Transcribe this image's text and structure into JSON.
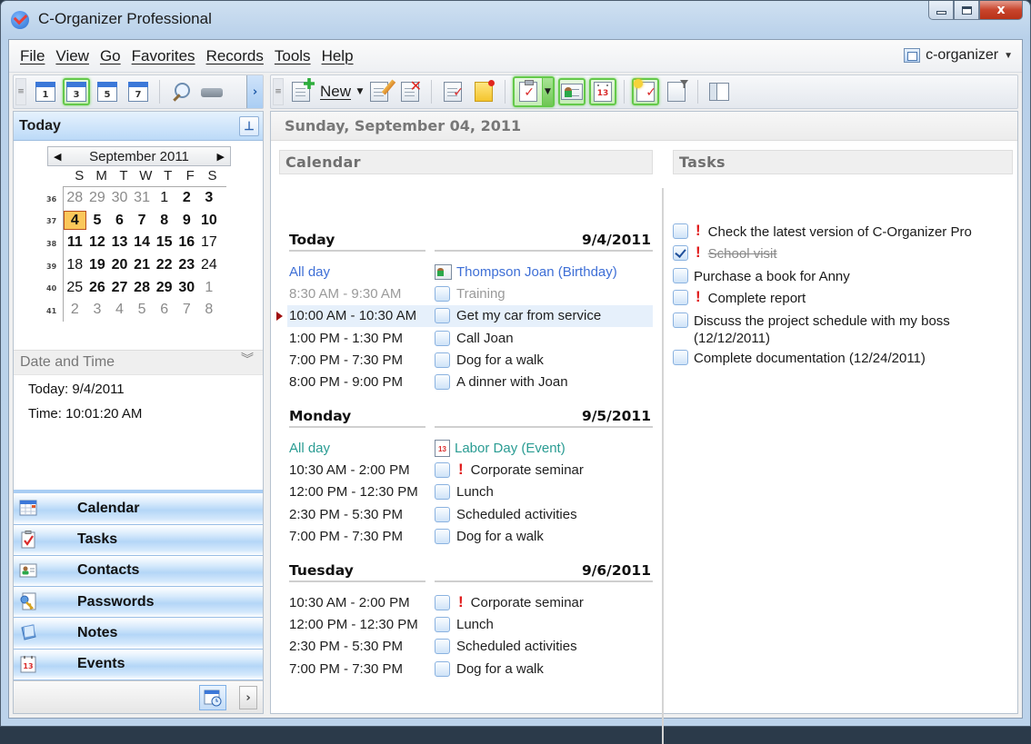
{
  "window": {
    "title": "C-Organizer Professional",
    "controls": {
      "minimize": "minimize",
      "maximize": "maximize",
      "close": "x"
    }
  },
  "menu": {
    "items": [
      "File",
      "View",
      "Go",
      "Favorites",
      "Records",
      "Tools",
      "Help"
    ],
    "profile": "c-organizer"
  },
  "left_toolbar": {
    "buttons": [
      {
        "name": "day-view",
        "label": "1",
        "active": false
      },
      {
        "name": "3-day-view",
        "label": "3",
        "active": true
      },
      {
        "name": "work-week-view",
        "label": "5",
        "active": false
      },
      {
        "name": "week-view",
        "label": "7",
        "active": false
      }
    ],
    "more": "›"
  },
  "right_toolbar": {
    "new_label": "New"
  },
  "today_panel": {
    "title": "Today",
    "pin": "⊥"
  },
  "mini_calendar": {
    "month_label": "September 2011",
    "weekdays": [
      "S",
      "M",
      "T",
      "W",
      "T",
      "F",
      "S"
    ],
    "weeks": [
      {
        "num": "36",
        "days": [
          [
            "28",
            "other"
          ],
          [
            "29",
            "other"
          ],
          [
            "30",
            "other"
          ],
          [
            "31",
            "other"
          ],
          [
            "1",
            ""
          ],
          [
            "2",
            "bold"
          ],
          [
            "3",
            "bold"
          ]
        ]
      },
      {
        "num": "37",
        "days": [
          [
            "4",
            "today"
          ],
          [
            "5",
            "bold"
          ],
          [
            "6",
            "bold"
          ],
          [
            "7",
            "bold"
          ],
          [
            "8",
            "bold"
          ],
          [
            "9",
            "bold"
          ],
          [
            "10",
            "bold"
          ]
        ]
      },
      {
        "num": "38",
        "days": [
          [
            "11",
            "bold"
          ],
          [
            "12",
            "bold"
          ],
          [
            "13",
            "bold"
          ],
          [
            "14",
            "bold"
          ],
          [
            "15",
            "bold"
          ],
          [
            "16",
            "bold"
          ],
          [
            "17",
            ""
          ]
        ]
      },
      {
        "num": "39",
        "days": [
          [
            "18",
            ""
          ],
          [
            "19",
            "bold"
          ],
          [
            "20",
            "bold"
          ],
          [
            "21",
            "bold"
          ],
          [
            "22",
            "bold"
          ],
          [
            "23",
            "bold"
          ],
          [
            "24",
            ""
          ]
        ]
      },
      {
        "num": "40",
        "days": [
          [
            "25",
            ""
          ],
          [
            "26",
            "bold"
          ],
          [
            "27",
            "bold"
          ],
          [
            "28",
            "bold"
          ],
          [
            "29",
            "bold"
          ],
          [
            "30",
            "bold"
          ],
          [
            "1",
            "other"
          ]
        ]
      },
      {
        "num": "41",
        "days": [
          [
            "2",
            "other"
          ],
          [
            "3",
            "other"
          ],
          [
            "4",
            "other"
          ],
          [
            "5",
            "other"
          ],
          [
            "6",
            "other"
          ],
          [
            "7",
            "other"
          ],
          [
            "8",
            "other"
          ]
        ]
      }
    ]
  },
  "date_time": {
    "title": "Date and Time",
    "today": "Today: 9/4/2011",
    "time": "Time: 10:01:20 AM"
  },
  "nav": {
    "items": [
      {
        "label": "Calendar",
        "icon": "calendar-icon"
      },
      {
        "label": "Tasks",
        "icon": "tasks-icon"
      },
      {
        "label": "Contacts",
        "icon": "contacts-icon"
      },
      {
        "label": "Passwords",
        "icon": "passwords-icon"
      },
      {
        "label": "Notes",
        "icon": "notes-icon"
      },
      {
        "label": "Events",
        "icon": "events-icon"
      }
    ],
    "more": "›"
  },
  "main": {
    "date_header": "Sunday, September 04, 2011",
    "calendar_title": "Calendar",
    "tasks_title": "Tasks",
    "days": [
      {
        "name": "Today",
        "date": "9/4/2011",
        "events": [
          {
            "time": "All day",
            "title": "Thompson Joan (Birthday)",
            "kind": "allday",
            "icon": "contact",
            "priority": false
          },
          {
            "time": "8:30 AM - 9:30 AM",
            "title": "Training",
            "kind": "past",
            "icon": "check",
            "priority": false
          },
          {
            "time": "10:00 AM - 10:30 AM",
            "title": "Get my car from service",
            "kind": "current",
            "icon": "check",
            "priority": false
          },
          {
            "time": "1:00 PM - 1:30 PM",
            "title": "Call Joan",
            "kind": "normal",
            "icon": "check",
            "priority": false
          },
          {
            "time": "7:00 PM - 7:30 PM",
            "title": "Dog for a walk",
            "kind": "normal",
            "icon": "check",
            "priority": false
          },
          {
            "time": "8:00 PM - 9:00 PM",
            "title": "A dinner with Joan",
            "kind": "normal",
            "icon": "check",
            "priority": false
          }
        ]
      },
      {
        "name": "Monday",
        "date": "9/5/2011",
        "events": [
          {
            "time": "All day",
            "title": "Labor Day (Event)",
            "kind": "event",
            "icon": "event",
            "priority": false
          },
          {
            "time": "10:30 AM - 2:00 PM",
            "title": "Corporate seminar",
            "kind": "normal",
            "icon": "check",
            "priority": true
          },
          {
            "time": "12:00 PM - 12:30 PM",
            "title": "Lunch",
            "kind": "normal",
            "icon": "check",
            "priority": false
          },
          {
            "time": "2:30 PM - 5:30 PM",
            "title": "Scheduled activities",
            "kind": "normal",
            "icon": "check",
            "priority": false
          },
          {
            "time": "7:00 PM - 7:30 PM",
            "title": "Dog for a walk",
            "kind": "normal",
            "icon": "check",
            "priority": false
          }
        ]
      },
      {
        "name": "Tuesday",
        "date": "9/6/2011",
        "events": [
          {
            "time": "10:30 AM - 2:00 PM",
            "title": "Corporate seminar",
            "kind": "normal",
            "icon": "check",
            "priority": true
          },
          {
            "time": "12:00 PM - 12:30 PM",
            "title": "Lunch",
            "kind": "normal",
            "icon": "check",
            "priority": false
          },
          {
            "time": "2:30 PM - 5:30 PM",
            "title": "Scheduled activities",
            "kind": "normal",
            "icon": "check",
            "priority": false
          },
          {
            "time": "7:00 PM - 7:30 PM",
            "title": "Dog for a walk",
            "kind": "normal",
            "icon": "check",
            "priority": false
          }
        ]
      }
    ],
    "tasks": [
      {
        "title": "Check the latest version of C-Organizer Pro",
        "done": false,
        "priority": true
      },
      {
        "title": "School visit",
        "done": true,
        "priority": true
      },
      {
        "title": "Purchase a book for Anny",
        "done": false,
        "priority": false
      },
      {
        "title": "Complete report",
        "done": false,
        "priority": true
      },
      {
        "title": "Discuss the project schedule with my boss (12/12/2011)",
        "done": false,
        "priority": false
      },
      {
        "title": "Complete documentation (12/24/2011)",
        "done": false,
        "priority": false
      }
    ]
  },
  "colors": {
    "allday": "#3e6fd6",
    "event": "#2a9c93",
    "past": "#9a9a9a",
    "priority": "#e01a1a",
    "today_cell": "#fbc75a",
    "active_tool": "#64c94a"
  }
}
